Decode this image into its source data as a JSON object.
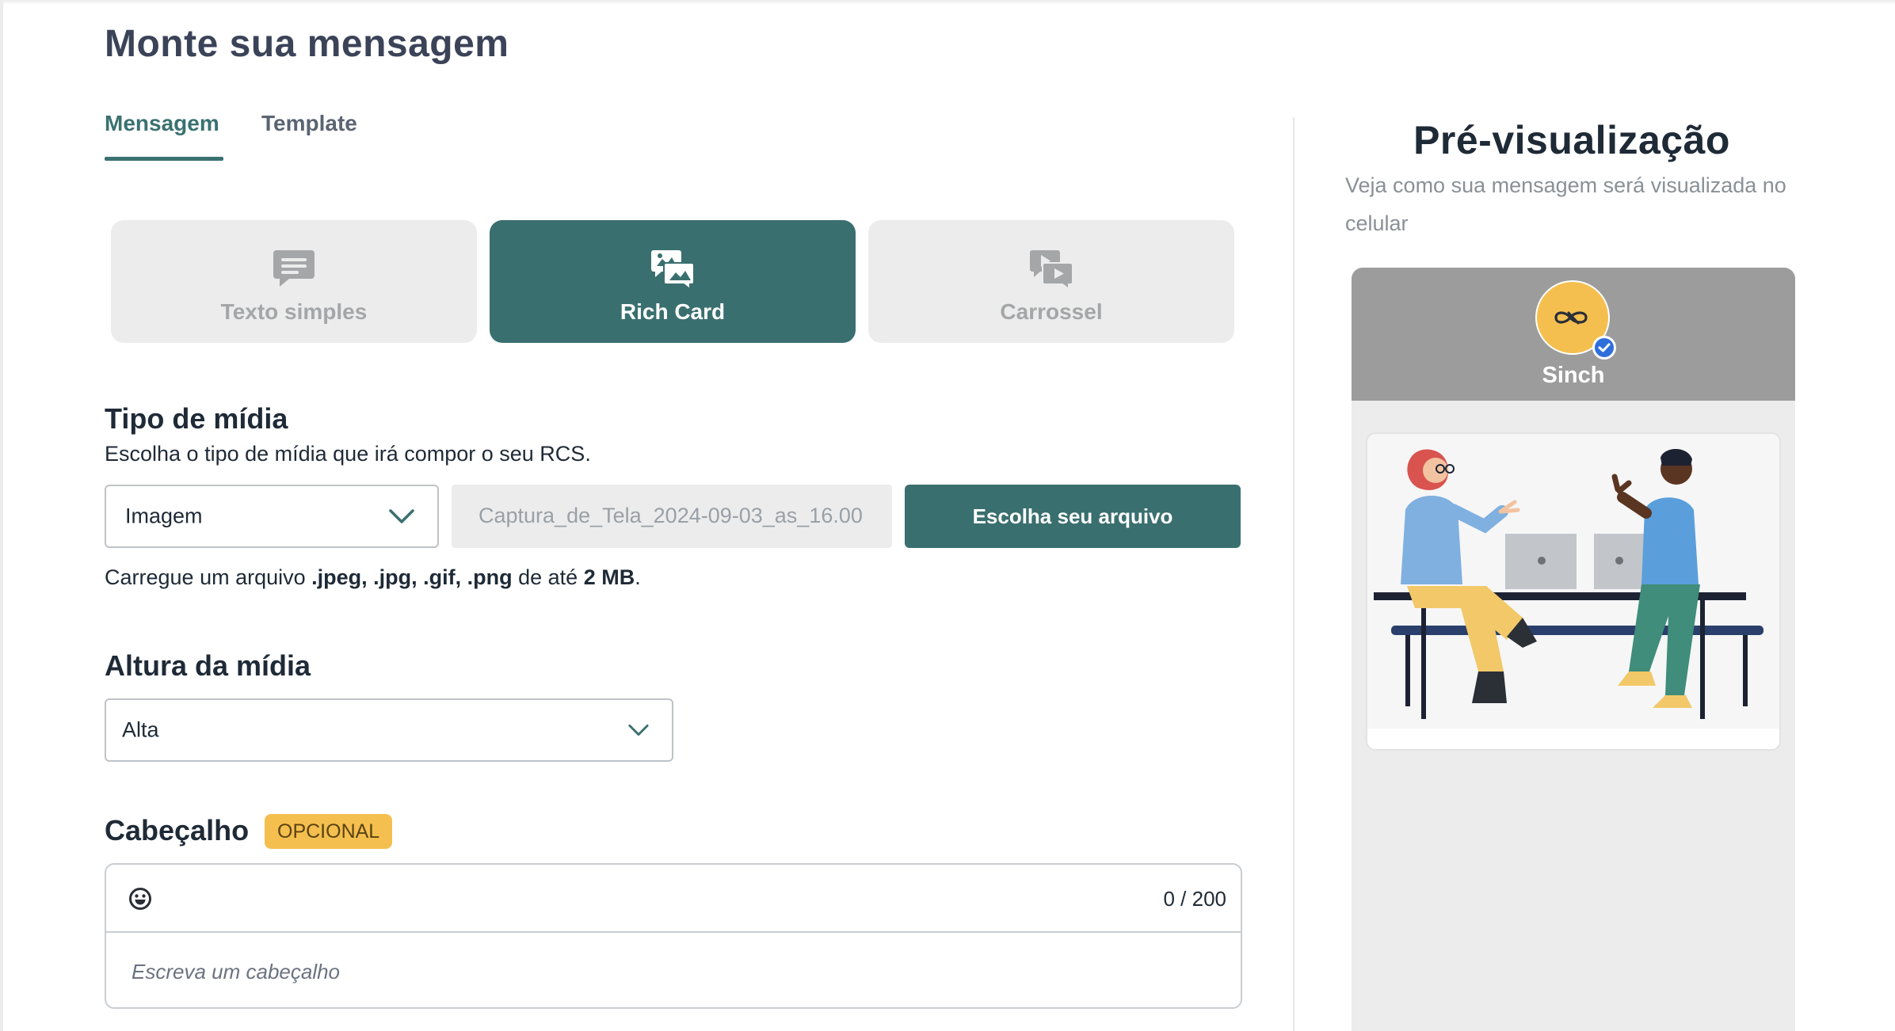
{
  "page": {
    "title": "Monte sua mensagem"
  },
  "tabs": [
    {
      "label": "Mensagem",
      "active": true
    },
    {
      "label": "Template",
      "active": false
    }
  ],
  "message_types": [
    {
      "label": "Texto simples",
      "icon": "chat-bubble-icon",
      "active": false
    },
    {
      "label": "Rich Card",
      "icon": "image-chat-icon",
      "active": true
    },
    {
      "label": "Carrossel",
      "icon": "video-chat-icon",
      "active": false
    }
  ],
  "media_type": {
    "heading": "Tipo de mídia",
    "description": "Escolha o tipo de mídia que irá compor o seu RCS.",
    "selected": "Imagem",
    "file_name": "Captura_de_Tela_2024-09-03_as_16.00",
    "choose_button": "Escolha seu arquivo",
    "help_prefix": "Carregue um arquivo ",
    "help_formats": ".jpeg, .jpg, .gif, .png",
    "help_middle": " de até ",
    "help_size": "2 MB",
    "help_suffix": "."
  },
  "media_height": {
    "heading": "Altura da mídia",
    "selected": "Alta"
  },
  "header": {
    "heading": "Cabeçalho",
    "badge": "OPCIONAL",
    "counter": "0 / 200",
    "placeholder": "Escreva um cabeçalho"
  },
  "preview": {
    "title": "Pré-visualização",
    "subtitle": "Veja como sua mensagem será visualizada no celular",
    "sender_name": "Sinch"
  },
  "colors": {
    "accent": "#3a6f6f",
    "badge": "#f5bf4f",
    "phone_header": "#9c9c9c"
  }
}
